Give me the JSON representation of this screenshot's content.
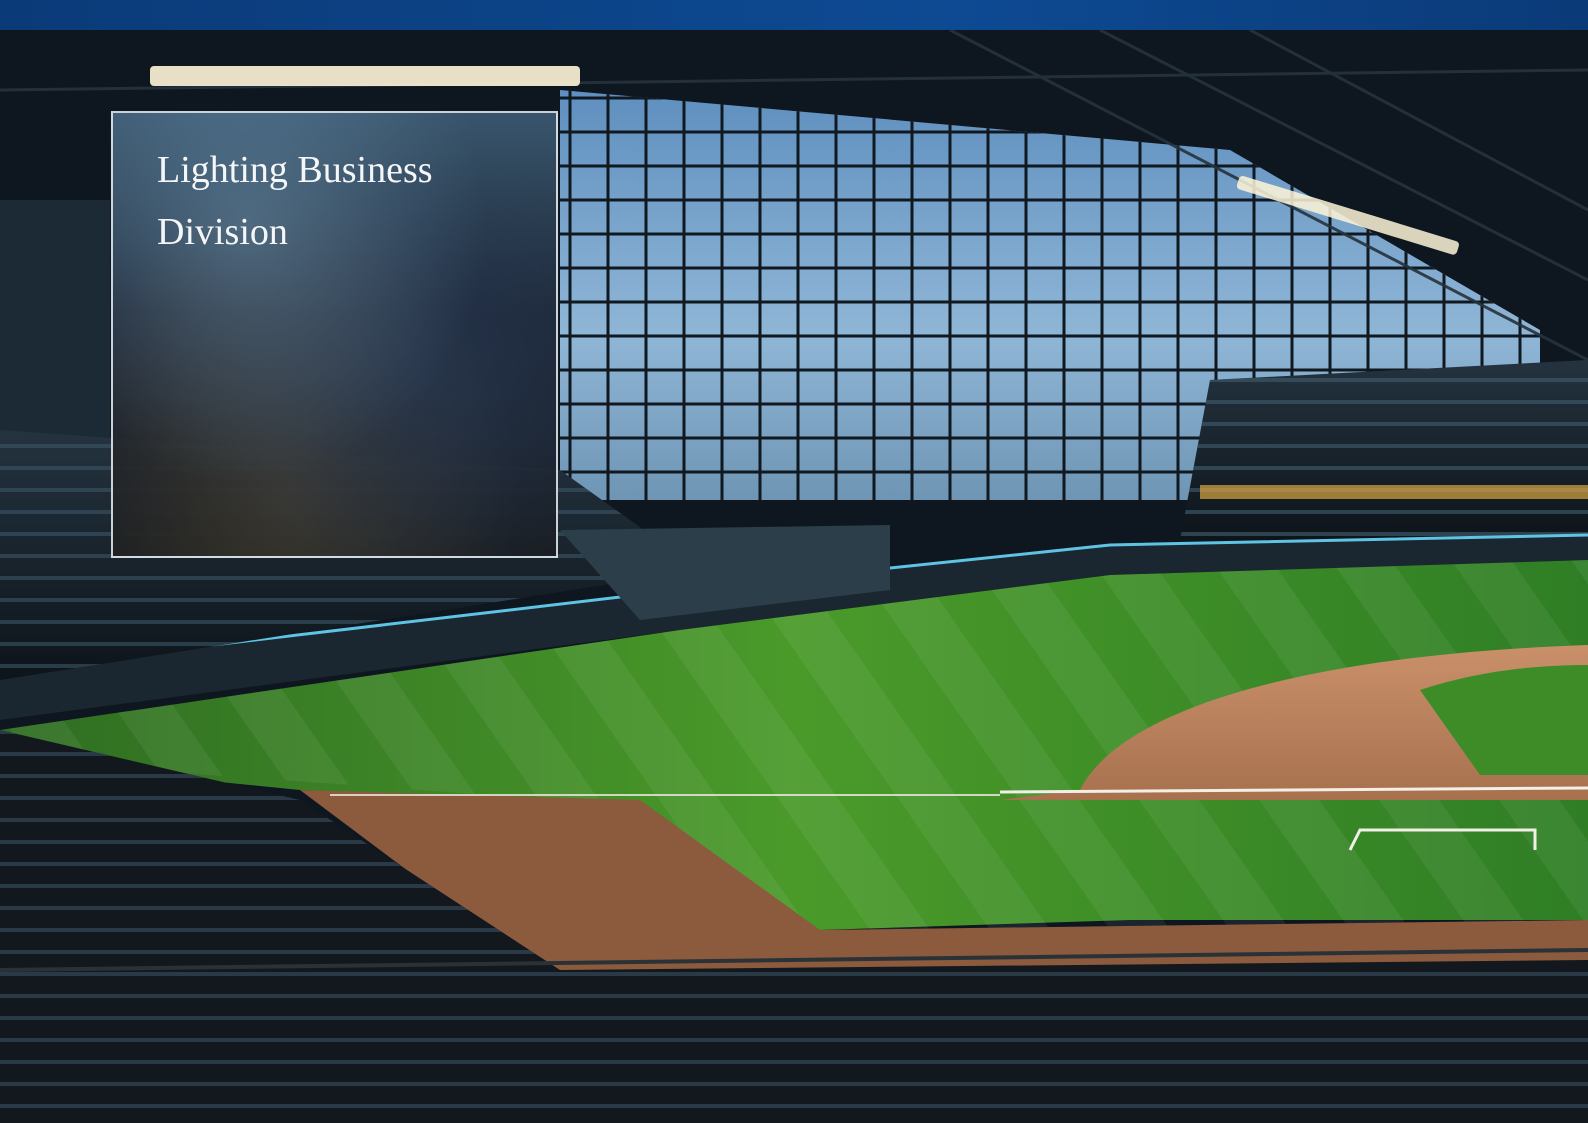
{
  "header": {
    "accent_color": "#0d4a93"
  },
  "photo": {
    "subject": "stadium-photo"
  },
  "panel": {
    "title": "Lighting Business\nDivision"
  }
}
